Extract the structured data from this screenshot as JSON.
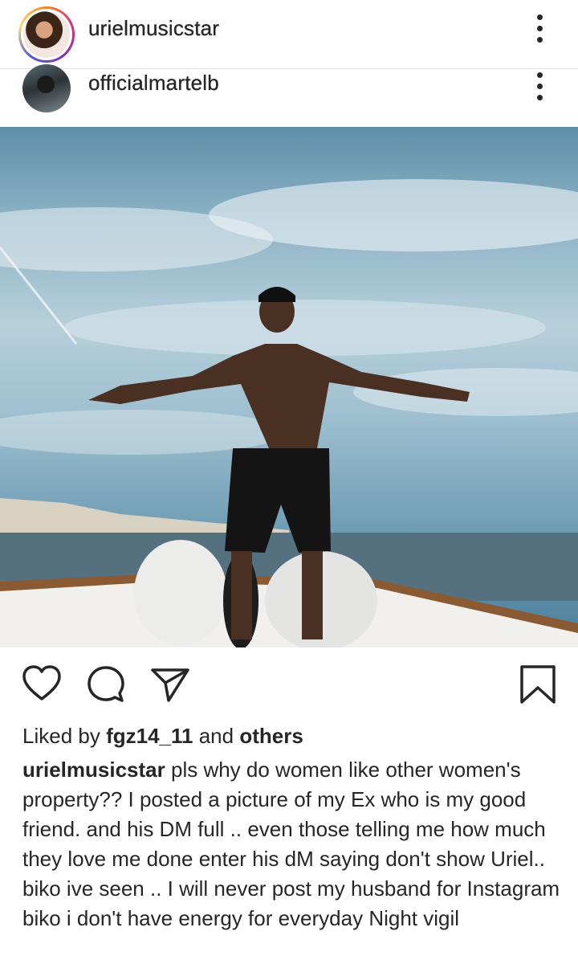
{
  "post_header": {
    "username": "urielmusicstar",
    "avatar_icon": "profile-avatar",
    "more_icon": "more-vertical-icon"
  },
  "embedded_header": {
    "username": "officialmartelb",
    "avatar_icon": "profile-avatar",
    "more_icon": "more-vertical-icon"
  },
  "actions": {
    "like_icon": "heart-icon",
    "comment_icon": "comment-icon",
    "share_icon": "send-icon",
    "save_icon": "bookmark-icon"
  },
  "likes": {
    "prefix": "Liked by",
    "user": "fgz14_11",
    "joiner": "and",
    "others": "others"
  },
  "caption": {
    "username": "urielmusicstar",
    "text": "pls why do women like other women's property?? I posted a picture of my Ex who is my good friend.  and his DM full .. even those telling me how much they love me done enter his dM saying don't show Uriel.. biko ive seen .. I will never post my husband for Instagram biko i don't have energy for everyday Night vigil"
  },
  "colors": {
    "text": "#262626",
    "divider": "#e4e4e4",
    "story_ring": "#dd2a7b"
  }
}
